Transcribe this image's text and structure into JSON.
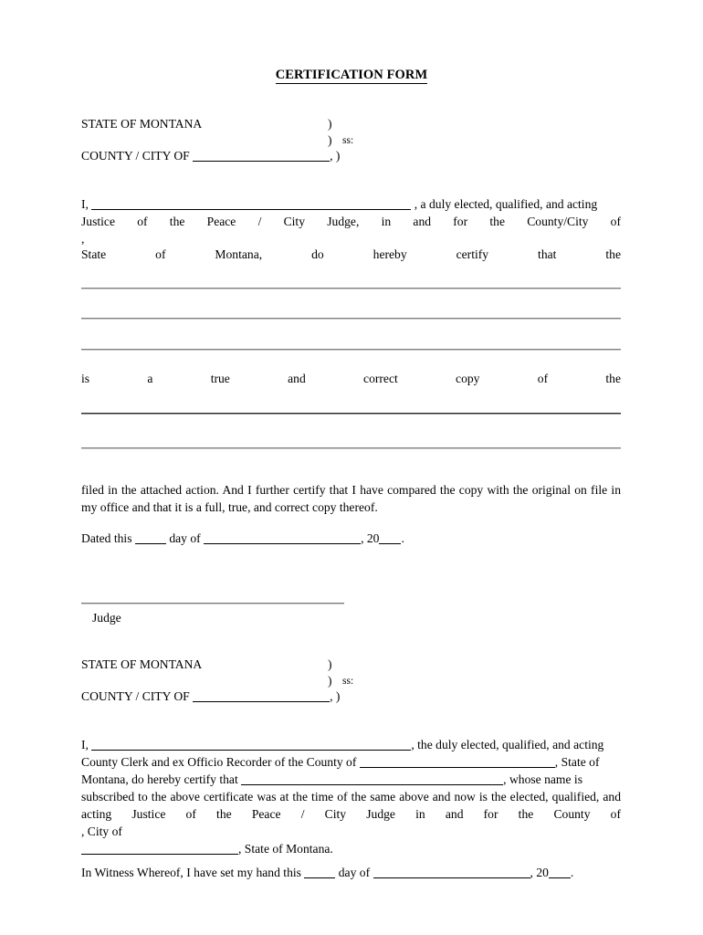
{
  "document": {
    "title": "CERTIFICATION FORM"
  },
  "venue_one": {
    "state_label": "STATE OF MONTANA",
    "paren": ")",
    "ss": "ss:",
    "county_label": "COUNTY / CITY OF",
    "county_suffix": ", )"
  },
  "judge_paragraph": {
    "line1_lead": "I,",
    "line1_tail": ", a duly elected, qualified, and acting",
    "line2": "Justice of the Peace / City Judge, in and for the County/City of",
    "line3": ",",
    "line4": "State of Montana, do hereby certify that the",
    "line5": "is a true and correct copy of the"
  },
  "certify_paragraph": {
    "text": "filed in the attached action.  And I further certify that I have compared the copy with the original on file in my office and that it is a full, true, and correct copy thereof."
  },
  "dated_line": {
    "prefix": "Dated this",
    "mid": "day of",
    "year_prefix": ", 20",
    "suffix": "."
  },
  "signature": {
    "label": "Judge"
  },
  "venue_two": {
    "state_label": "STATE OF MONTANA",
    "paren": ")",
    "ss": "ss:",
    "county_label": "COUNTY / CITY OF",
    "county_suffix": ", )"
  },
  "clerk_paragraph": {
    "line1_lead": "I,",
    "line1_tail": ", the duly elected, qualified, and acting",
    "line2_lead": "County Clerk and ex Officio Recorder of the County of",
    "line2_tail": ", State of",
    "line3_lead": "Montana, do hereby certify that",
    "line3_tail": ", whose name is",
    "line4": "subscribed to the above certificate was at the time of the same above and now is the elected, qualified, and acting Justice of the Peace / City Judge in and for the County of",
    "line5": ", City of",
    "line6_tail": ", State of Montana."
  },
  "witness_line": {
    "prefix": "In Witness Whereof, I have set my hand this",
    "mid": "day of",
    "year_prefix": ", 20",
    "suffix": "."
  },
  "colors": {
    "text": "#000000",
    "rule_gray": "#808080",
    "rule_dark": "#2b2b2b",
    "background": "#ffffff"
  }
}
